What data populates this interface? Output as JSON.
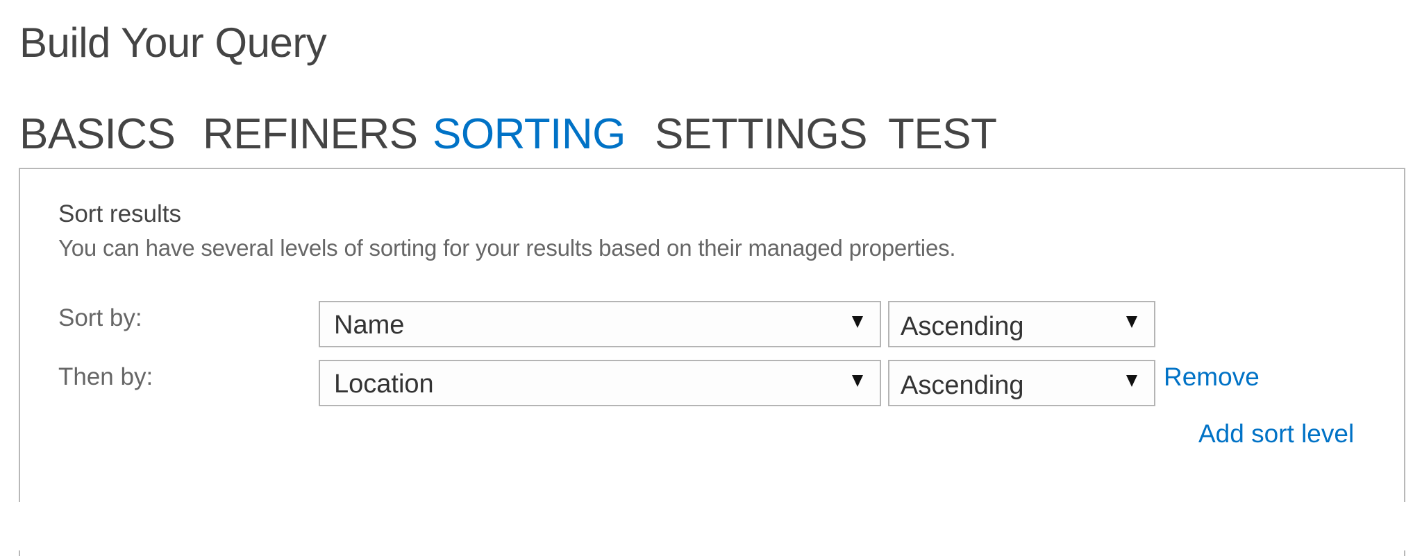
{
  "page": {
    "title": "Build Your Query"
  },
  "tabs": [
    {
      "label": "BASICS",
      "active": false
    },
    {
      "label": "REFINERS",
      "active": false
    },
    {
      "label": "SORTING",
      "active": true
    },
    {
      "label": "SETTINGS",
      "active": false
    },
    {
      "label": "TEST",
      "active": false
    }
  ],
  "sorting": {
    "section_title": "Sort results",
    "description": "You can have several levels of sorting for your results based on their managed properties.",
    "levels": [
      {
        "label": "Sort by:",
        "property": "Name",
        "direction": "Ascending",
        "removable": false
      },
      {
        "label": "Then by:",
        "property": "Location",
        "direction": "Ascending",
        "removable": true
      }
    ],
    "remove_label": "Remove",
    "add_label": "Add sort level"
  },
  "icons": {
    "dropdown": "chevron-down-icon (▼)"
  },
  "colors": {
    "accent": "#0072c6",
    "text": "#444444",
    "muted_text": "#666666",
    "border": "#b8b8b8"
  }
}
